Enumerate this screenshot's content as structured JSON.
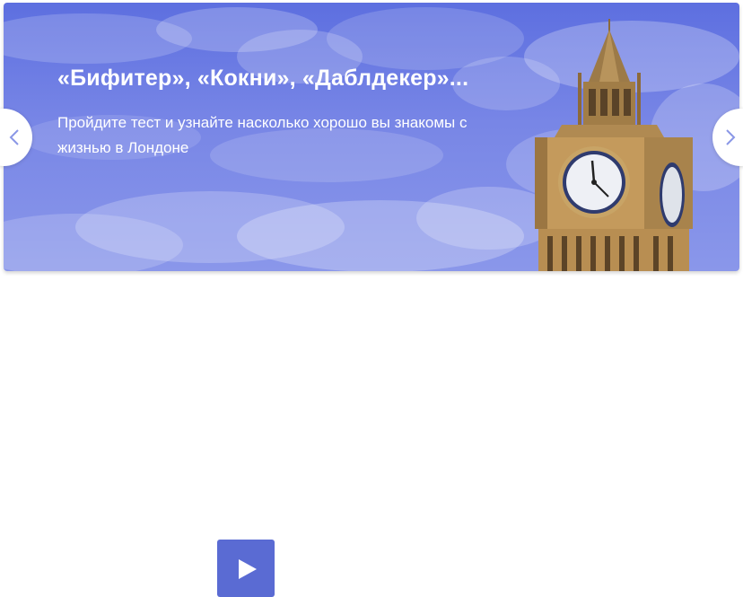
{
  "banner": {
    "title": "«Бифитер», «Кокни», «Даблдекер»...",
    "subtitle": "Пройдите тест и узнайте насколько хорошо вы знакомы с жизнью в Лондоне",
    "image": "big-ben-clock-tower",
    "background_color": "#6b7ce3"
  },
  "navigation": {
    "prev_icon": "chevron-left-icon",
    "next_icon": "chevron-right-icon",
    "arrow_color": "#8a97e6"
  },
  "player": {
    "play_icon": "play-icon",
    "button_color": "#5a6bd3"
  }
}
